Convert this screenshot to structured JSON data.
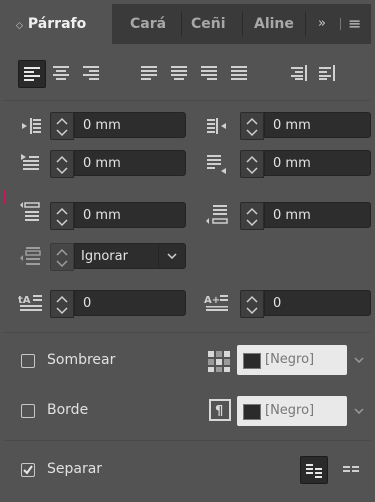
{
  "tabs": [
    {
      "label": "Párrafo",
      "active": true
    },
    {
      "label": "Cará",
      "active": false
    },
    {
      "label": "Ceñi",
      "active": false
    },
    {
      "label": "Aline",
      "active": false
    }
  ],
  "tab_overflow": "»",
  "menu_glyph": "≡",
  "alignment_buttons": [
    "align-left",
    "align-center",
    "align-right",
    "justify-left",
    "justify-center",
    "justify-right",
    "justify-all",
    "align-towards-spine",
    "align-away-from-spine"
  ],
  "selected_alignment": "align-left",
  "fields": {
    "left_indent": "0 mm",
    "right_indent": "0 mm",
    "first_line_indent": "0 mm",
    "last_line_indent": "0 mm",
    "space_before": "0 mm",
    "space_after": "0 mm",
    "align_to_grid": "Ignorar",
    "drop_cap_lines": "0",
    "drop_cap_chars": "0"
  },
  "shading": {
    "label": "Sombrear",
    "checked": false,
    "color": "[Negro]"
  },
  "border": {
    "label": "Borde",
    "checked": false,
    "color": "[Negro]"
  },
  "split": {
    "label": "Separar",
    "checked": true
  },
  "colors": {
    "panel_bg": "#535353",
    "tabbar_bg": "#3a3a3a",
    "field_bg": "#2d2d2d",
    "accent_line": "#c2185b"
  }
}
